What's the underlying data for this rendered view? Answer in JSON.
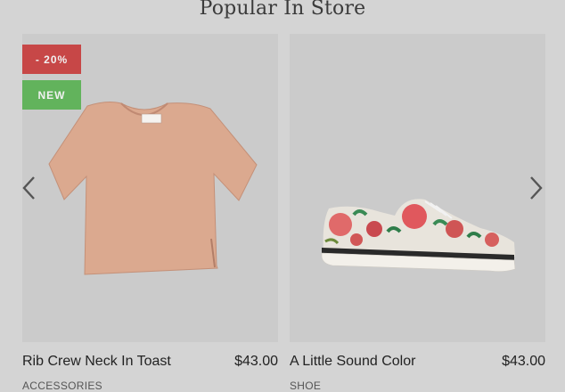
{
  "section": {
    "title": "Popular In Store"
  },
  "products": [
    {
      "name": "Rib Crew Neck In Toast",
      "price": "$43.00",
      "category": "ACCESSORIES",
      "badges": {
        "sale": "- 20%",
        "new": "NEW"
      },
      "image": "tshirt-image"
    },
    {
      "name": "A Little Sound Color",
      "price": "$43.00",
      "category": "SHOE",
      "image": "sneaker-image"
    }
  ],
  "nav": {
    "prev": "chevron-left-icon",
    "next": "chevron-right-icon"
  },
  "colors": {
    "sale": "#c74747",
    "new": "#62b35c",
    "background": "#d4d4d4",
    "card": "#cbcbcb"
  }
}
